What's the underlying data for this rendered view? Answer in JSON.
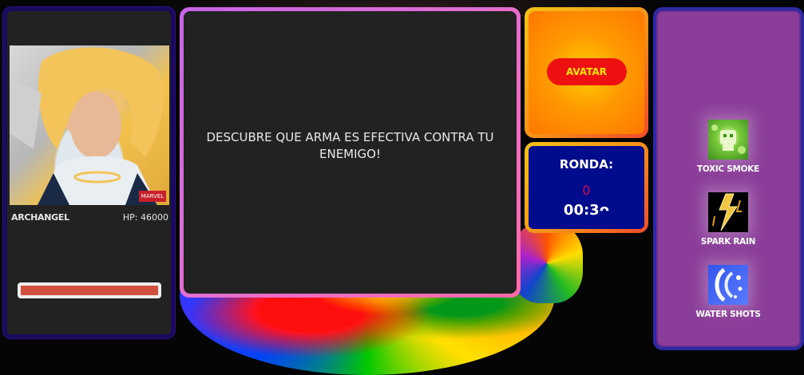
{
  "character": {
    "name": "ARCHANGEL",
    "hp_label": "HP: 46000",
    "hp_fraction": 1.0
  },
  "message": {
    "text": "DESCUBRE QUE ARMA ES EFECTIVA CONTRA TU ENEMIGO!"
  },
  "avatar": {
    "button_label": "AVATAR"
  },
  "round": {
    "label": "RONDA:",
    "number": "0",
    "timer": "00:3ᴖ"
  },
  "weapons": [
    {
      "label": "TOXIC SMOKE",
      "icon": "toxic-smoke-icon"
    },
    {
      "label": "SPARK RAIN",
      "icon": "spark-rain-icon"
    },
    {
      "label": "WATER SHOTS",
      "icon": "water-shots-icon"
    }
  ],
  "colors": {
    "hp_fill": "#d05040",
    "avatar_button": "#ee1111",
    "avatar_button_text": "#ffe600",
    "round_bg": "#000c8c",
    "round_number": "#cc0d4f",
    "weapons_bg": "#8b3e99"
  }
}
